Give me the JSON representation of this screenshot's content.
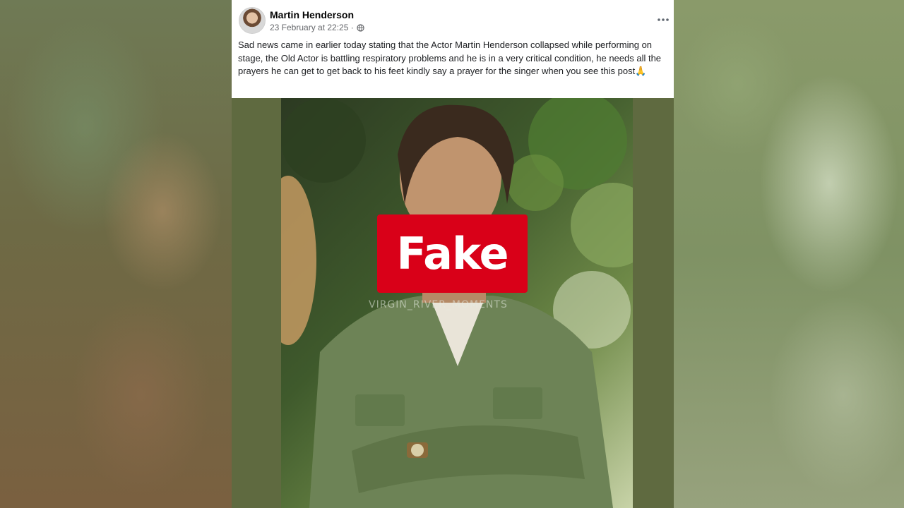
{
  "post": {
    "author": "Martin Henderson",
    "timestamp": "23 February at 22:25 ·",
    "privacy_icon": "globe-icon",
    "more_icon": "more-dots-icon",
    "text": "Sad news came in earlier today stating that the Actor Martin  Henderson collapsed while performing on stage, the Old Actor is battling respiratory problems and he is in a very critical condition, he needs all the prayers he can get to get back to his feet kindly say a prayer for the singer when you see this post🙏"
  },
  "image": {
    "watermark": "VIRGIN_RIVER_MOMENTS",
    "verdict_label": "Fake",
    "verdict_color": "#d90018"
  }
}
